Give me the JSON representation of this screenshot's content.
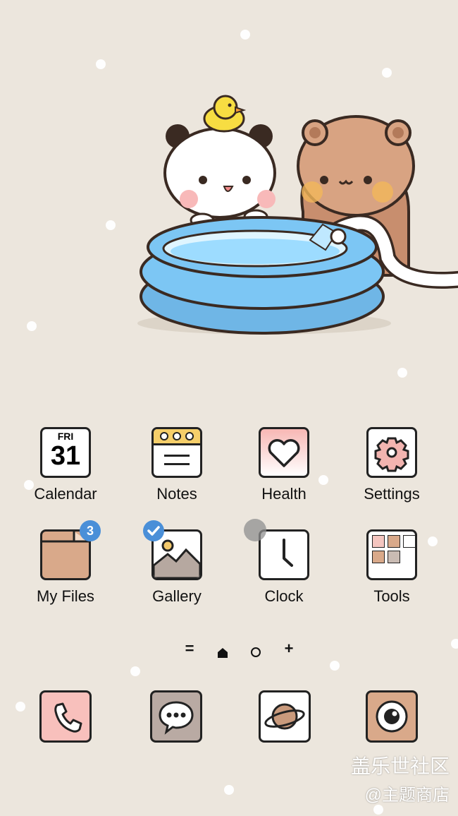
{
  "apps_row1": [
    {
      "label": "Calendar",
      "day": "FRI",
      "date": "31"
    },
    {
      "label": "Notes"
    },
    {
      "label": "Health"
    },
    {
      "label": "Settings"
    }
  ],
  "apps_row2": [
    {
      "label": "My Files",
      "badge": "3"
    },
    {
      "label": "Gallery"
    },
    {
      "label": "Clock"
    },
    {
      "label": "Tools"
    }
  ],
  "page_indicator": {
    "left": "=",
    "right": "+"
  },
  "dock": [
    "phone-icon",
    "messages-icon",
    "internet-icon",
    "camera-icon"
  ],
  "watermark": {
    "line1": "盖乐世社区",
    "line2": "@主题商店"
  },
  "colors": {
    "background": "#ece6dd",
    "notes_header": "#f6cf6a",
    "health_tile": "#f9c4c0",
    "folder": "#d9a98a",
    "badge": "#4a8fd8",
    "pool": "#7cc6f4"
  }
}
